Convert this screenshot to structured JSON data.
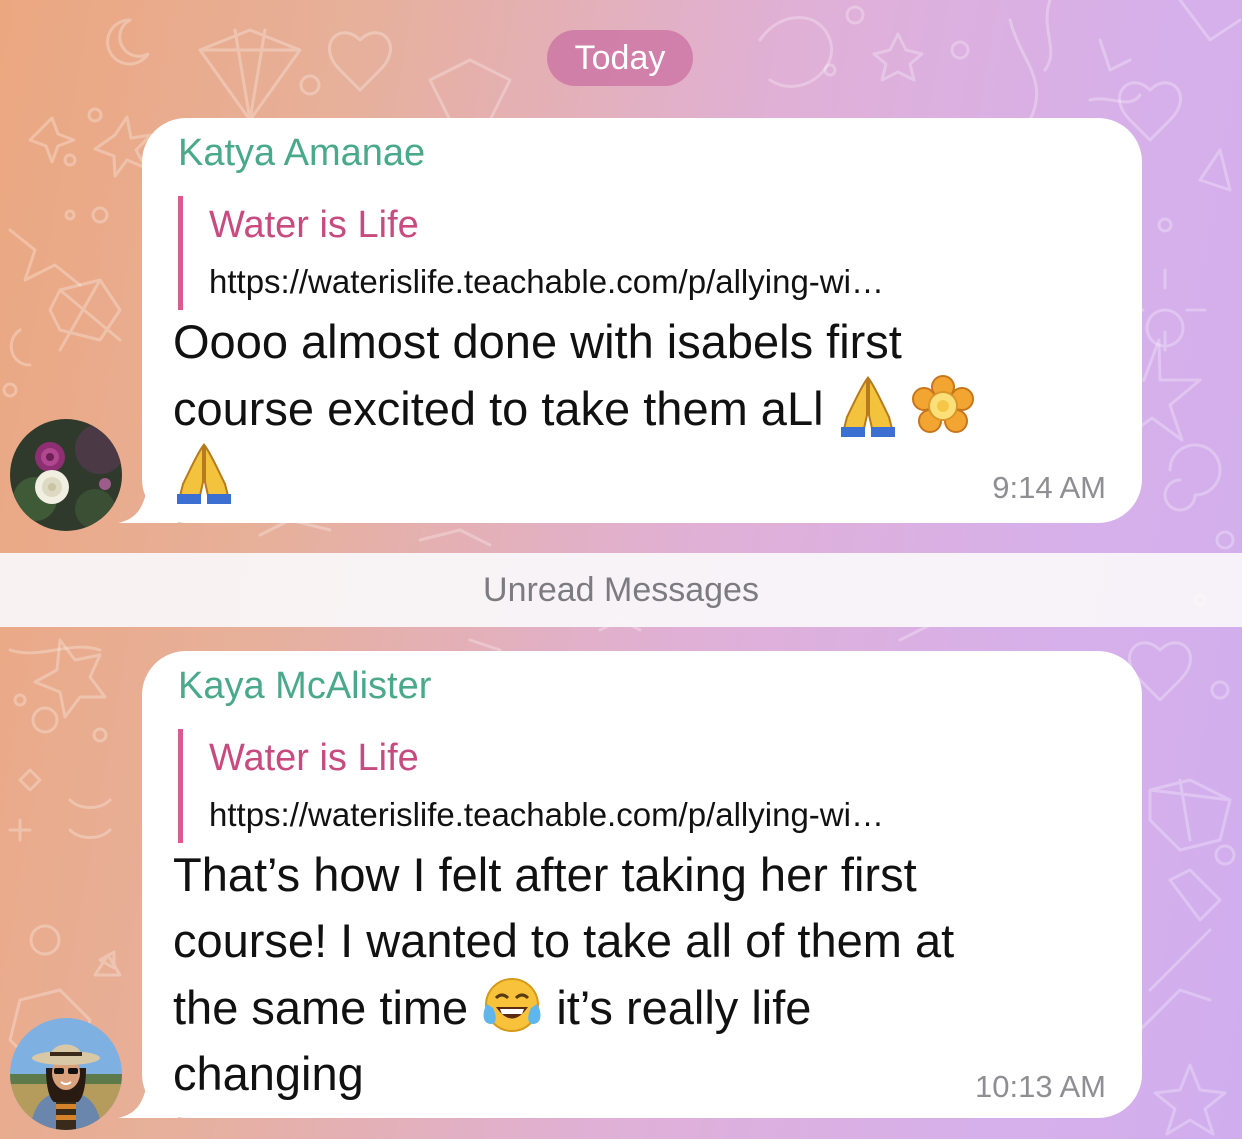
{
  "date_separator": "Today",
  "unread_divider": "Unread Messages",
  "messages": [
    {
      "sender": "Katya Amanae",
      "quote_title": "Water is Life",
      "quote_url": "https://waterislife.teachable.com/p/allying-wi…",
      "text_lines": [
        "Oooo almost done with isabels first",
        "course excited to take them aLl"
      ],
      "emojis": [
        "folded-hands",
        "blossom",
        "folded-hands"
      ],
      "time": "9:14 AM",
      "avatar": "rose-flowers-avatar"
    },
    {
      "sender": "Kaya McAlister",
      "quote_title": "Water is Life",
      "quote_url": "https://waterislife.teachable.com/p/allying-wi…",
      "text_lines": [
        "That’s how I felt after taking her first",
        "course! I wanted to take all of them at",
        "the same time",
        "it’s really life",
        "changing"
      ],
      "emojis": [
        "face-with-tears-of-joy"
      ],
      "time": "10:13 AM",
      "avatar": "woman-with-hat-avatar"
    }
  ],
  "colors": {
    "sender_name": "#4aa98a",
    "quote_bar": "#d95b8f",
    "quote_title": "#c84b80",
    "date_pill": "#cd78a5",
    "timestamp": "#8e8e93"
  }
}
